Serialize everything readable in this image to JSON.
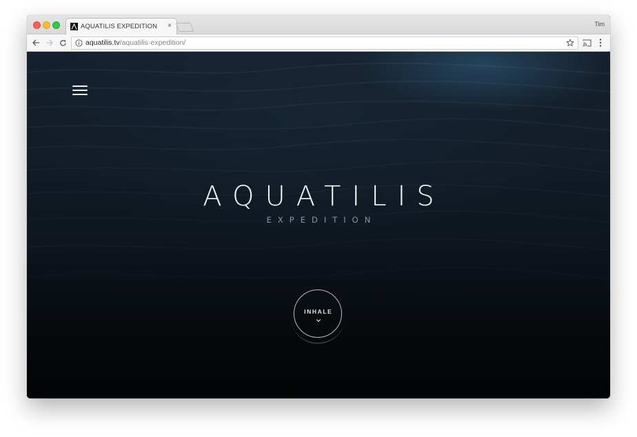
{
  "browser": {
    "tab": {
      "title": "AQUATILIS EXPEDITION",
      "close_glyph": "×",
      "favicon_icon": "aquatilis-a-icon"
    },
    "profile_name": "Tim",
    "url": {
      "host": "aquatilis.tv",
      "path": "/aquatilis-expedition/"
    },
    "icons": [
      "back-arrow-icon",
      "forward-arrow-icon",
      "reload-icon",
      "info-icon",
      "star-icon",
      "cast-icon",
      "more-vert-icon"
    ]
  },
  "page": {
    "menu_icon": "hamburger-icon",
    "title": "AQUATILIS",
    "subtitle": "EXPEDITION",
    "cta": {
      "label": "INHALE",
      "icon": "chevron-down-icon"
    },
    "colors": {
      "title": "#f4f4f4",
      "subtitle": "#8e949b",
      "background_top": "#15212e",
      "background_bottom": "#020304"
    }
  }
}
